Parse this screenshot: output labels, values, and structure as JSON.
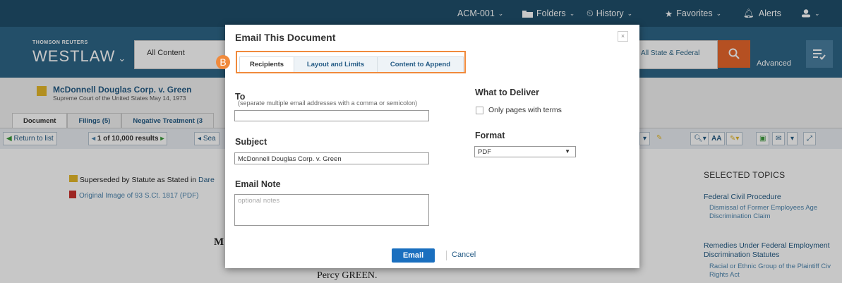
{
  "topnav": {
    "client": "ACM-001",
    "folders": "Folders",
    "history": "History",
    "favorites": "Favorites",
    "alerts": "Alerts"
  },
  "brand": {
    "small": "THOMSON REUTERS",
    "big": "WESTLAW"
  },
  "search": {
    "scope": "All Content",
    "jurisdiction": "All State & Federal",
    "advanced": "Advanced"
  },
  "document": {
    "title": "McDonnell Douglas Corp. v. Green",
    "subtitle": "Supreme Court of the United States   May 14, 1973",
    "tabs": [
      "Document",
      "Filings (5)",
      "Negative Treatment (3"
    ],
    "toolbar": {
      "return": "Return to list",
      "results": "1 of 10,000 results",
      "search": "Sea"
    },
    "superseded_text": "Superseded by Statute as Stated in",
    "superseded_link": "Dare",
    "original_image": "Original Image of 93 S.Ct. 1817 (PDF)",
    "body_letter": "M",
    "body_name": "Percy GREEN."
  },
  "sidebar": {
    "title": "SELECTED TOPICS",
    "topics": [
      {
        "heading": "Federal Civil Procedure",
        "sub": "Dismissal of Former Employees Age Discrimination Claim"
      },
      {
        "heading": "Remedies Under Federal Employment Discrimination Statutes",
        "sub": "Racial or Ethnic Group of the Plaintiff Civ Rights Act"
      }
    ]
  },
  "modal": {
    "title": "Email This Document",
    "close": "×",
    "tabs": [
      "Recipients",
      "Layout and Limits",
      "Content to Append"
    ],
    "badge": "B",
    "to_label": "To",
    "to_hint": "(separate multiple email addresses with a comma or semicolon)",
    "to_value": "",
    "subject_label": "Subject",
    "subject_value": "McDonnell Douglas Corp. v. Green",
    "note_label": "Email Note",
    "note_placeholder": "optional notes",
    "deliver_label": "What to Deliver",
    "only_pages": "Only pages with terms",
    "format_label": "Format",
    "format_value": "PDF",
    "email_button": "Email",
    "cancel": "Cancel"
  },
  "colors": {
    "topbar": "#1f4f6b",
    "header": "#2d6687",
    "search_button": "#e8672c",
    "highlight": "#f08a3c",
    "primary_button": "#1a6fbf"
  }
}
